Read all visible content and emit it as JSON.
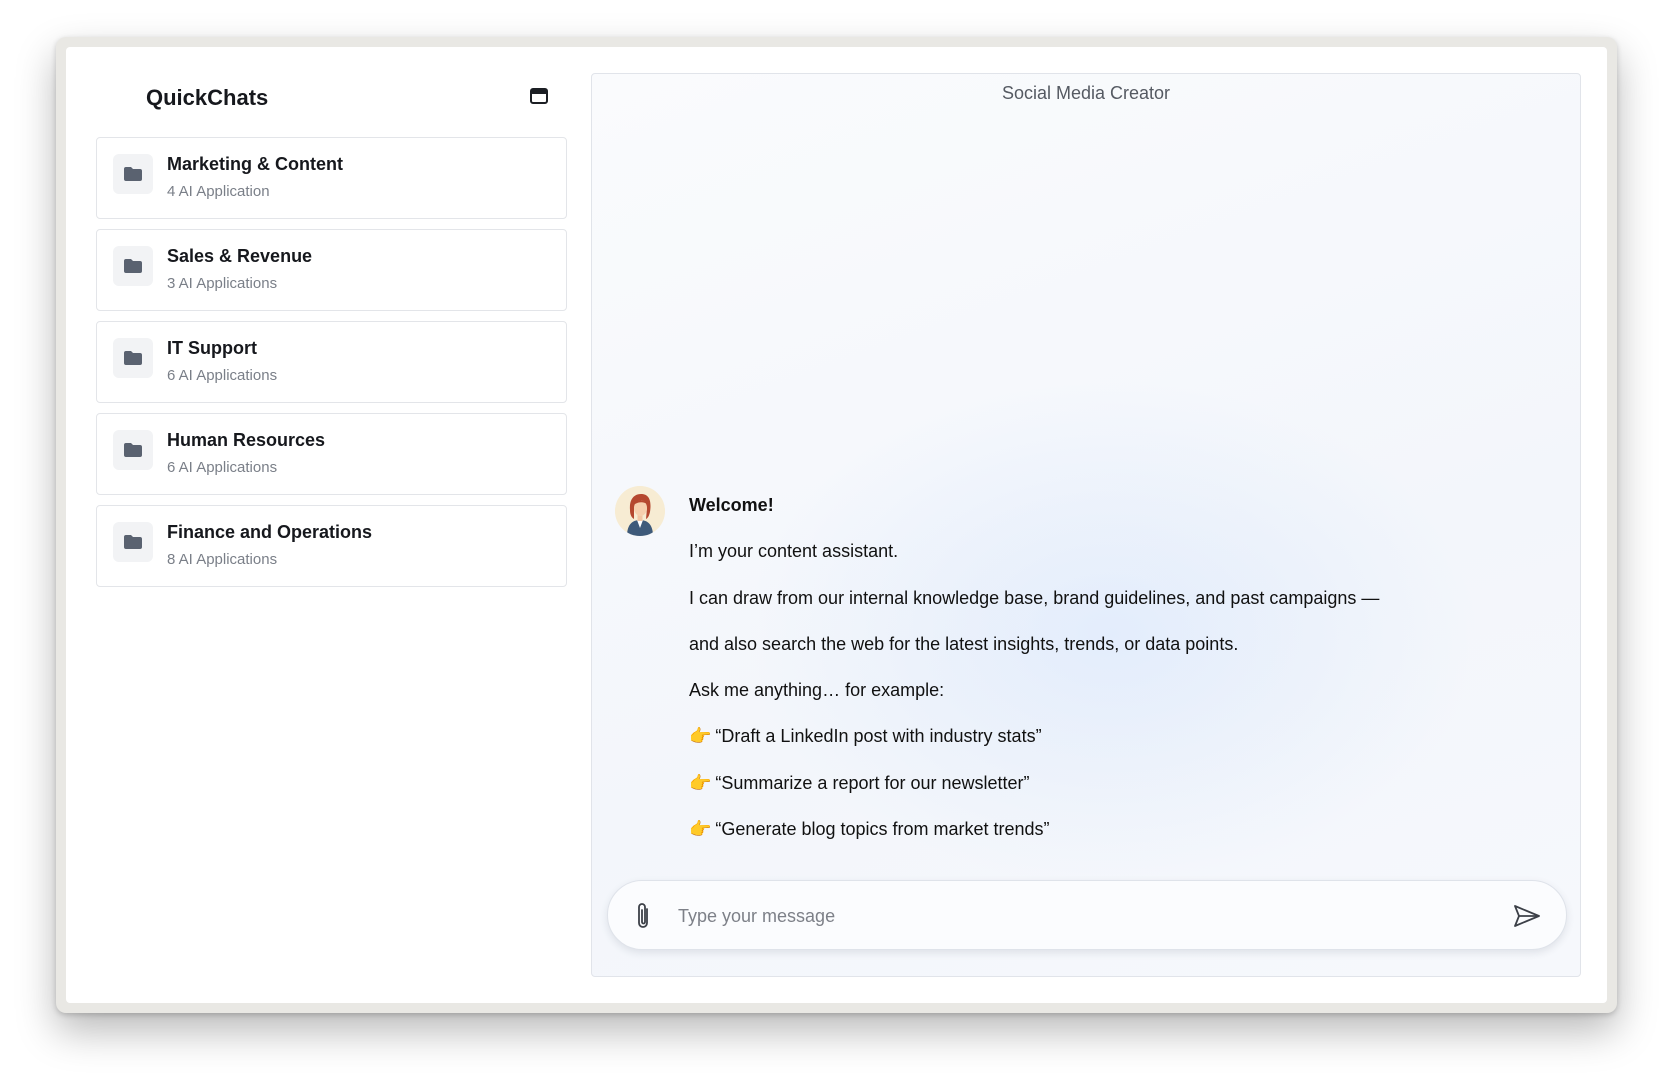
{
  "sidebar": {
    "title": "QuickChats",
    "collapse_icon": "panel-collapse-icon",
    "folders": [
      {
        "name": "Marketing & Content",
        "count": "4 AI Application",
        "icon": "folder-icon"
      },
      {
        "name": "Sales & Revenue",
        "count": "3 AI Applications",
        "icon": "folder-icon"
      },
      {
        "name": "IT Support",
        "count": "6 AI Applications",
        "icon": "folder-icon"
      },
      {
        "name": "Human Resources",
        "count": "6 AI Applications",
        "icon": "folder-icon"
      },
      {
        "name": "Finance and Operations",
        "count": "8 AI Applications",
        "icon": "folder-icon"
      }
    ]
  },
  "chat": {
    "title": "Social Media Creator",
    "avatar_icon": "assistant-avatar",
    "message": {
      "heading": "Welcome!",
      "lines": [
        "I’m your content assistant.",
        "I can draw from our internal knowledge base, brand guidelines, and past campaigns —",
        "and also search the web for the latest insights, trends, or data points.",
        "Ask me anything… for example:"
      ],
      "bullet_emoji": "👉",
      "examples": [
        "“Draft a LinkedIn post with industry stats”",
        "“Summarize a report for our newsletter”",
        "“Generate blog topics from market trends”"
      ]
    },
    "composer": {
      "placeholder": "Type your message",
      "value": "",
      "attach_icon": "paperclip-icon",
      "send_icon": "send-icon"
    }
  },
  "colors": {
    "folder_icon": "#5a6270",
    "border": "#e3e5e9",
    "muted_text": "#7a7f88",
    "panel_bg": "#f5f7fb"
  }
}
